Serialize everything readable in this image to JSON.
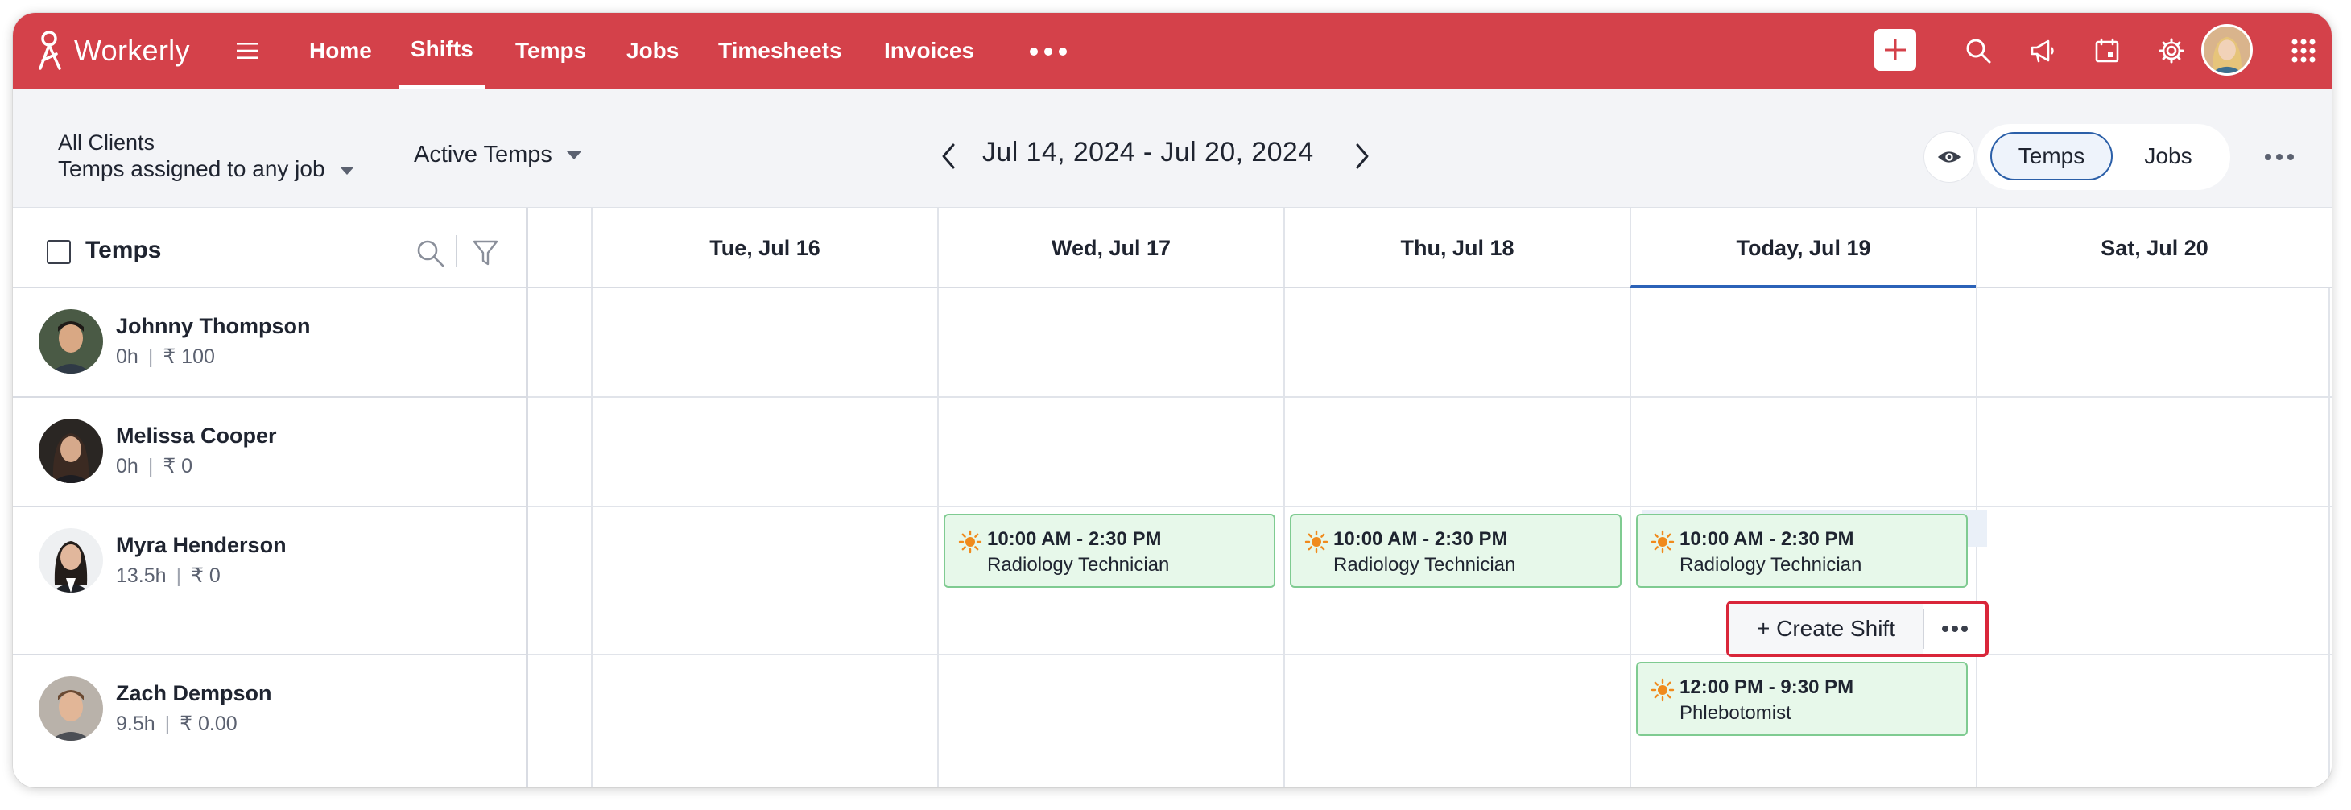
{
  "app": {
    "brand": "Workerly",
    "brand_color": "#d4414a"
  },
  "nav": {
    "items": [
      {
        "label": "Home",
        "active": false
      },
      {
        "label": "Shifts",
        "active": true
      },
      {
        "label": "Temps",
        "active": false
      },
      {
        "label": "Jobs",
        "active": false
      },
      {
        "label": "Timesheets",
        "active": false
      },
      {
        "label": "Invoices",
        "active": false
      }
    ],
    "icons": [
      "hamburger-icon",
      "more-horizontal-icon",
      "plus-icon",
      "search-icon",
      "megaphone-icon",
      "calendar-icon",
      "gear-icon",
      "user-avatar",
      "apps-grid-icon"
    ]
  },
  "toolbar": {
    "client_label": "All Clients",
    "client_filter": "Temps assigned to any job",
    "temps_filter": "Active Temps",
    "date_range": "Jul 14, 2024 - Jul 20, 2024",
    "view_temps": "Temps",
    "view_jobs": "Jobs",
    "view_selected": "Temps",
    "accent_color": "#2b5fa8"
  },
  "left_panel": {
    "title": "Temps"
  },
  "days": [
    {
      "label": "Tue, Jul 16",
      "today": false
    },
    {
      "label": "Wed, Jul 17",
      "today": false
    },
    {
      "label": "Thu, Jul 18",
      "today": false
    },
    {
      "label": "Today, Jul 19",
      "today": true
    },
    {
      "label": "Sat, Jul 20",
      "today": false
    }
  ],
  "temps": [
    {
      "name": "Johnny Thompson",
      "hours": "0h",
      "pay": "₹ 100"
    },
    {
      "name": "Melissa Cooper",
      "hours": "0h",
      "pay": "₹ 0"
    },
    {
      "name": "Myra Henderson",
      "hours": "13.5h",
      "pay": "₹ 0"
    },
    {
      "name": "Zach Dempson",
      "hours": "9.5h",
      "pay": "₹ 0.00"
    }
  ],
  "shifts": [
    {
      "temp": "Myra Henderson",
      "day": "Wed, Jul 17",
      "time": "10:00 AM - 2:30 PM",
      "role": "Radiology Technician"
    },
    {
      "temp": "Myra Henderson",
      "day": "Thu, Jul 18",
      "time": "10:00 AM - 2:30 PM",
      "role": "Radiology Technician"
    },
    {
      "temp": "Myra Henderson",
      "day": "Today, Jul 19",
      "time": "10:00 AM - 2:30 PM",
      "role": "Radiology Technician"
    },
    {
      "temp": "Zach Dempson",
      "day": "Today, Jul 19",
      "time": "12:00 PM - 9:30 PM",
      "role": "Phlebotomist"
    }
  ],
  "create_shift": {
    "label": "+ Create Shift",
    "highlight_color": "#d9263a"
  },
  "shift_colors": {
    "fill": "#e7f8ea",
    "border": "#7fcb91",
    "sun_icon": "#f08a1c"
  }
}
